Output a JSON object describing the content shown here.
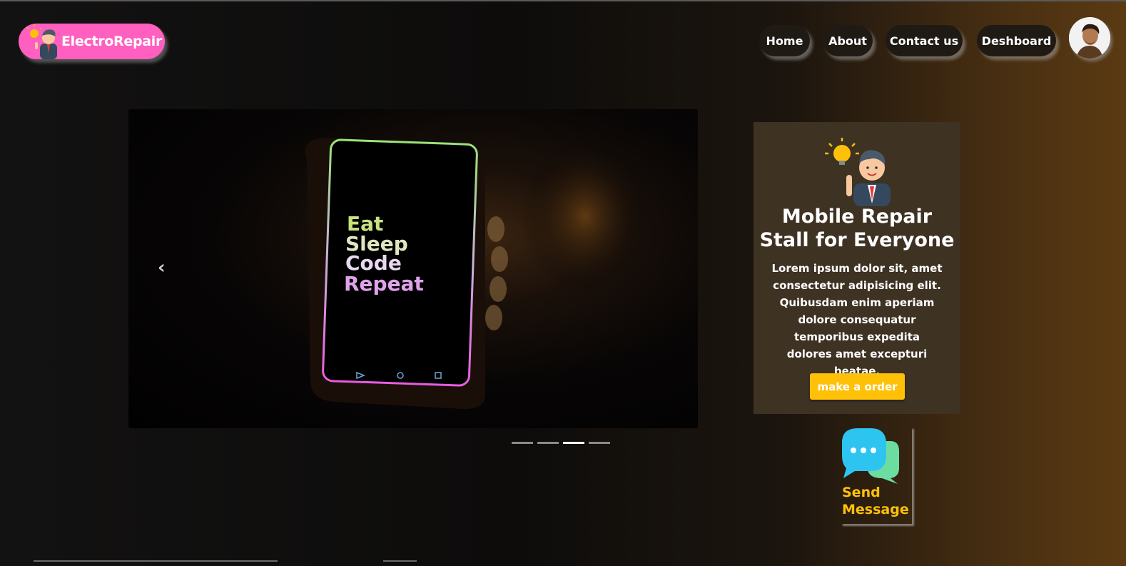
{
  "brand": {
    "name": "ElectroRepair",
    "logo_icon": "businessman-lightbulb-icon"
  },
  "nav": {
    "home": "Home",
    "about": "About",
    "contact": "Contact us",
    "dashboard": "Deshboard"
  },
  "user": {
    "avatar_icon": "user-avatar"
  },
  "carousel": {
    "screen_lines": [
      "Eat",
      "Sleep",
      "Code",
      "Repeat"
    ],
    "prev_icon": "chevron-left-icon",
    "next_icon": "chevron-right-icon",
    "active_slide": 3,
    "slide_count": 4
  },
  "card": {
    "icon": "businessman-lightbulb-icon",
    "title_line1": "Mobile Repair",
    "title_line2": "Stall for Everyone",
    "text": "Lorem ipsum dolor sit, amet consectetur adipisicing elit. Quibusdam enim aperiam dolore consequatur temporibus expedita dolores amet excepturi beatae.",
    "button": "make a order"
  },
  "message": {
    "line1": "Send",
    "line2": "Message",
    "icon": "chat-bubbles-icon"
  },
  "colors": {
    "brand_pink": "#ff5fbf",
    "accent_yellow": "#ffc107",
    "card_bg": "#3e3223"
  }
}
